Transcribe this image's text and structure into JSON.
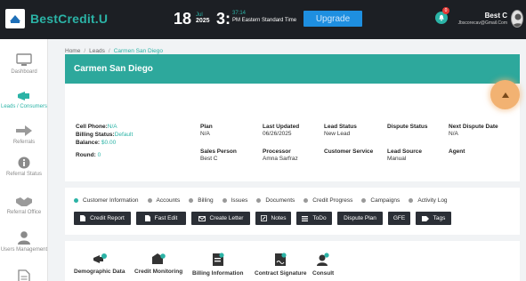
{
  "header": {
    "brand": "BestCredit.U",
    "date_day": "18",
    "date_month": "Jul",
    "date_year": "2025",
    "time_hour": "3:",
    "time_minute": "37:14",
    "time_zone": "PM Eastern Standard Time",
    "upgrade_label": "Upgrade",
    "notification_count": "0",
    "user_name": "Best C",
    "user_email": "Jbscorecav@Gmail.Com"
  },
  "sidebar": {
    "items": [
      {
        "label": "Dashboard",
        "icon": "monitor-icon"
      },
      {
        "label": "Leads / Consumers",
        "icon": "megaphone-icon"
      },
      {
        "label": "Referrals",
        "icon": "arrow-right-icon"
      },
      {
        "label": "Referral Status",
        "icon": "info-icon"
      },
      {
        "label": "Referral Office",
        "icon": "handshake-icon"
      },
      {
        "label": "Users Management",
        "icon": "user-icon"
      },
      {
        "label": "",
        "icon": "document-icon"
      }
    ]
  },
  "breadcrumb": {
    "home": "Home",
    "leads": "Leads",
    "current": "Carmen San Diego"
  },
  "lead": {
    "name": "Carmen San Diego",
    "cell_phone_label": "Cell Phone:",
    "cell_phone_value": "N/A",
    "billing_status_label": "Billing Status:",
    "billing_status_value": "Default",
    "balance_label": "Balance:",
    "balance_value": "$0.00",
    "round_label": "Round:",
    "round_value": "0",
    "plan_label": "Plan",
    "plan_value": "N/A",
    "last_updated_label": "Last Updated",
    "last_updated_value": "06/26/2025",
    "lead_status_label": "Lead Status",
    "lead_status_value": "New Lead",
    "dispute_status_label": "Dispute Status",
    "dispute_status_value": "",
    "next_dispute_date_label": "Next Dispute Date",
    "next_dispute_date_value": "N/A",
    "sales_person_label": "Sales Person",
    "sales_person_value": "Best C",
    "processor_label": "Processor",
    "processor_value": "Amna Sarfraz",
    "customer_service_label": "Customer Service",
    "customer_service_value": "",
    "lead_source_label": "Lead Source",
    "lead_source_value": "Manual",
    "agent_label": "Agent",
    "agent_value": ""
  },
  "tabs": [
    {
      "label": "Customer Information",
      "active": true
    },
    {
      "label": "Accounts",
      "active": false
    },
    {
      "label": "Billing",
      "active": false
    },
    {
      "label": "Issues",
      "active": false
    },
    {
      "label": "Documents",
      "active": false
    },
    {
      "label": "Credit Progress",
      "active": false
    },
    {
      "label": "Campaigns",
      "active": false
    },
    {
      "label": "Activity Log",
      "active": false
    }
  ],
  "actions": [
    {
      "label": "Credit Report",
      "icon": "file-icon"
    },
    {
      "label": "Fast Edit",
      "icon": "file-icon"
    },
    {
      "label": "Create Letter",
      "icon": "envelope-icon"
    },
    {
      "label": "Notes",
      "icon": "pencil-icon"
    },
    {
      "label": "ToDo",
      "icon": "list-icon"
    },
    {
      "label": "Dispute Plan",
      "icon": ""
    },
    {
      "label": "GFE",
      "icon": ""
    },
    {
      "label": "Tags",
      "icon": "tag-icon"
    }
  ],
  "bottom_items": [
    {
      "label": "Demographic Data",
      "icon": "demographic-icon"
    },
    {
      "label": "Credit Monitoring",
      "icon": "credit-monitoring-icon"
    },
    {
      "label": "Billing Information",
      "icon": "billing-icon"
    },
    {
      "label": "Contract Signature",
      "icon": "contract-icon"
    },
    {
      "label": "Consult",
      "icon": "consult-icon"
    }
  ],
  "colors": {
    "accent": "#2bb3a6",
    "banner": "#2da89c",
    "topbar": "#1c1f24",
    "button_dark": "#2b2f36",
    "upgrade": "#1e8fe0",
    "collapse": "#f2b272"
  }
}
